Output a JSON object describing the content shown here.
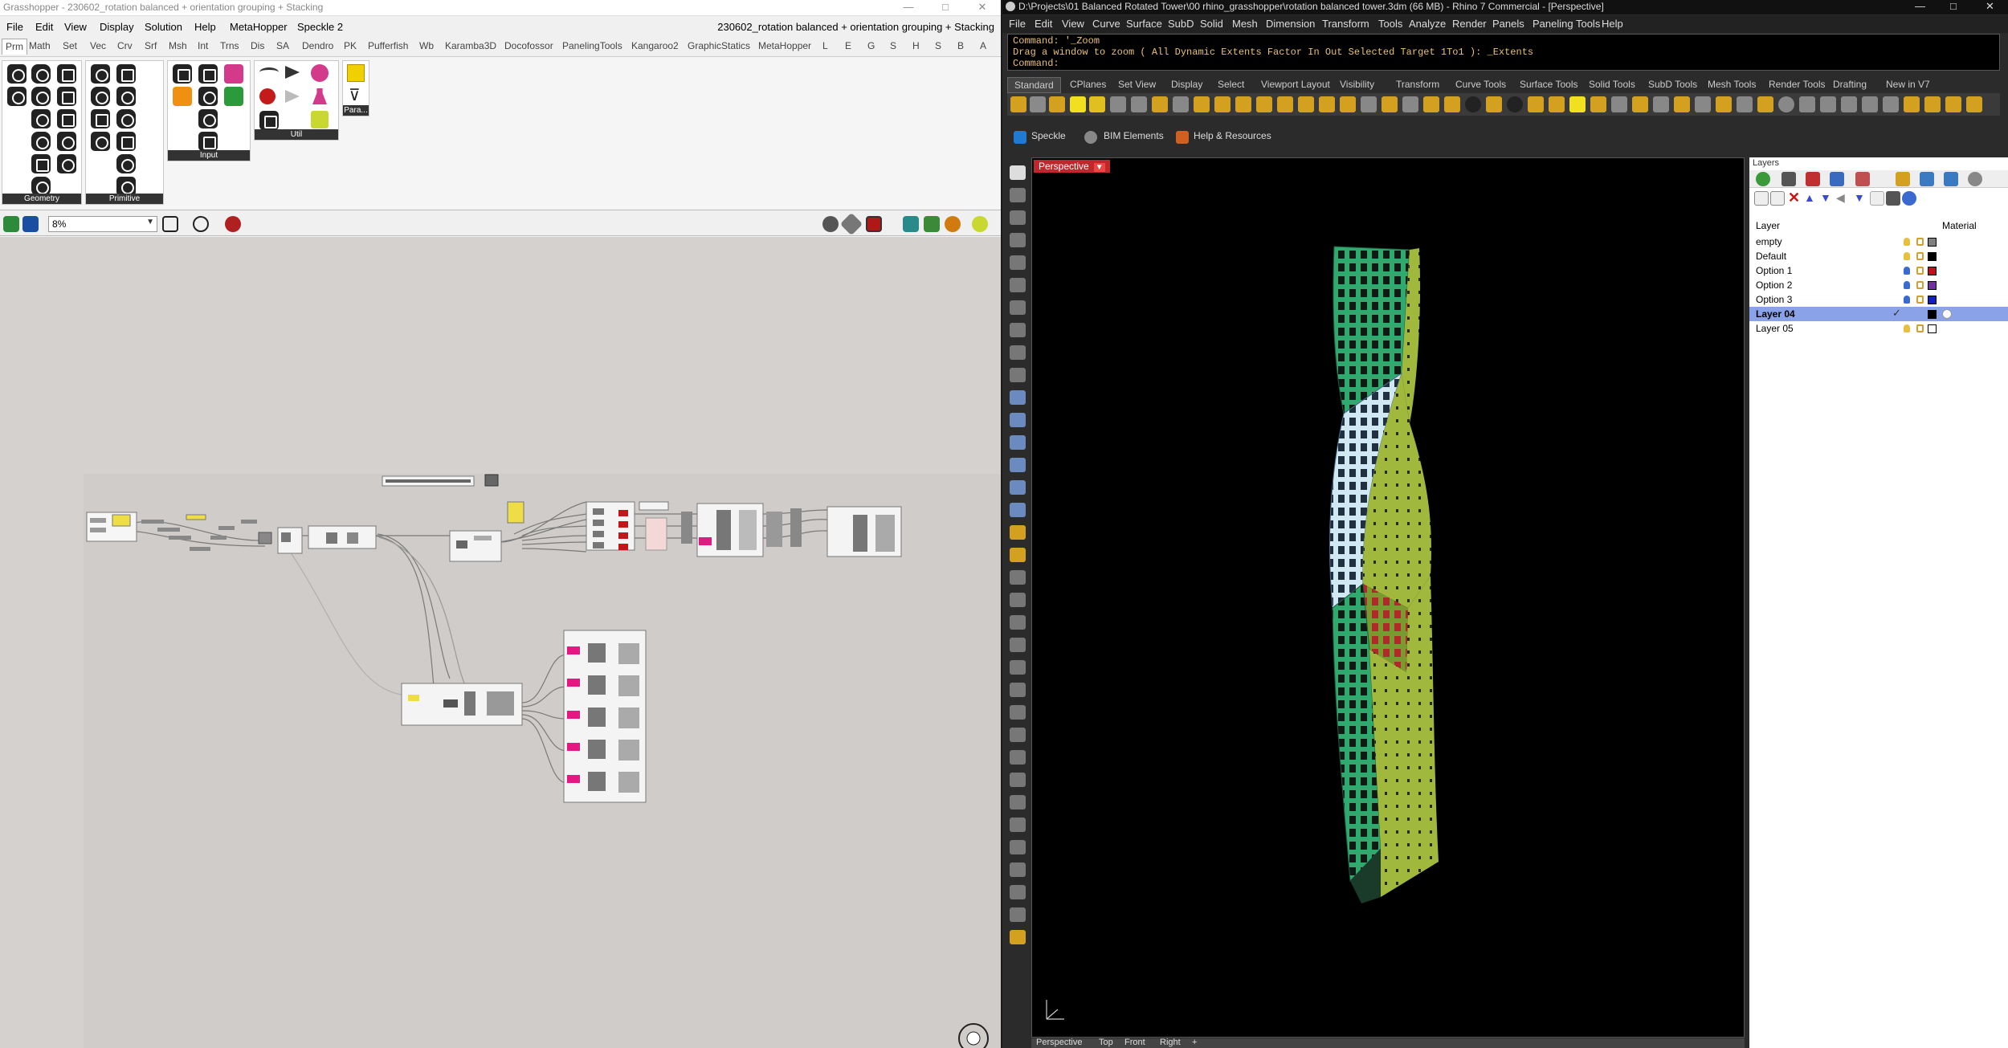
{
  "grasshopper": {
    "window_title": "Grasshopper - 230602_rotation balanced + orientation grouping + Stacking",
    "document_title": "230602_rotation balanced + orientation grouping + Stacking",
    "menu": [
      "File",
      "Edit",
      "View",
      "Display",
      "Solution",
      "Help",
      "MetaHopper",
      "Speckle 2"
    ],
    "tabs": [
      "Prm",
      "Math",
      "Set",
      "Vec",
      "Crv",
      "Srf",
      "Msh",
      "Int",
      "Trns",
      "Dis",
      "SA",
      "Dendro",
      "PK",
      "Pufferfish",
      "Wb",
      "Karamba3D",
      "Docofossor",
      "PanelingTools",
      "Kangaroo2",
      "GraphicStatics",
      "MetaHopper",
      "L",
      "E",
      "G",
      "S",
      "H",
      "S",
      "B",
      "A"
    ],
    "active_tab": "Prm",
    "panels": [
      "Geometry",
      "Primitive",
      "Input",
      "Util"
    ],
    "param_label": "Para...",
    "zoom": "8%"
  },
  "rhino": {
    "window_title": "D:\\Projects\\01 Balanced Rotated Tower\\00 rhino_grasshopper\\rotation balanced tower.3dm (66 MB) - Rhino 7 Commercial - [Perspective]",
    "menu": [
      "File",
      "Edit",
      "View",
      "Curve",
      "Surface",
      "SubD",
      "Solid",
      "Mesh",
      "Dimension",
      "Transform",
      "Tools",
      "Analyze",
      "Render",
      "Panels",
      "Paneling Tools",
      "Help"
    ],
    "command_history": [
      "Command: '_Zoom",
      "Drag a window to zoom ( All  Dynamic  Extents  Factor  In  Out  Selected  Target  1To1 ): _Extents"
    ],
    "command_prompt": "Command:",
    "toolbar_tabs": [
      "Standard",
      "CPlanes",
      "Set View",
      "Display",
      "Select",
      "Viewport Layout",
      "Visibility",
      "Transform",
      "Curve Tools",
      "Surface Tools",
      "Solid Tools",
      "SubD Tools",
      "Mesh Tools",
      "Render Tools",
      "Drafting",
      "New in V7"
    ],
    "plugins": [
      "Speckle",
      "BIM Elements",
      "Help & Resources"
    ],
    "viewport_label": "Perspective",
    "viewport_tabs": [
      "Perspective",
      "Top",
      "Front",
      "Right"
    ],
    "layers_panel": {
      "title": "Layers",
      "col_layer": "Layer",
      "col_material": "Material",
      "rows": [
        {
          "name": "empty",
          "color": "#808080"
        },
        {
          "name": "Default",
          "color": "#000000"
        },
        {
          "name": "Option 1",
          "color": "#c0101a"
        },
        {
          "name": "Option 2",
          "color": "#7030a0"
        },
        {
          "name": "Option 3",
          "color": "#1020c0"
        },
        {
          "name": "Layer 04",
          "color": "#000000",
          "current": true
        },
        {
          "name": "Layer 05",
          "color": "#ffffff"
        }
      ]
    }
  }
}
